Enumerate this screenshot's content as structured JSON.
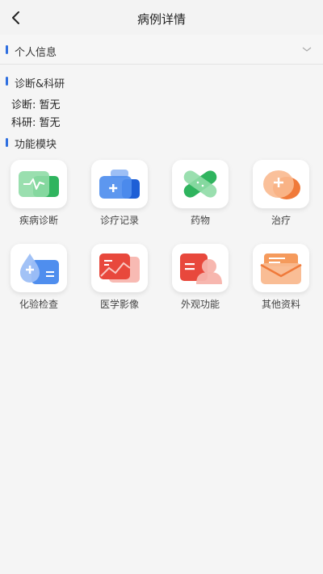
{
  "nav": {
    "title": "病例详情"
  },
  "sections": {
    "personal": "个人信息",
    "diagnosis": "诊断&科研",
    "modules": "功能模块"
  },
  "fields": [
    {
      "label": "诊断:",
      "value": "暂无"
    },
    {
      "label": "科研:",
      "value": "暂无"
    }
  ],
  "modules": [
    {
      "label": "疾病诊断",
      "icon": "disease-diagnosis-icon",
      "color": "#3fbf6a"
    },
    {
      "label": "诊疗记录",
      "icon": "medical-record-icon",
      "color": "#2f73e0"
    },
    {
      "label": "药物",
      "icon": "medicine-icon",
      "color": "#3fbf6a"
    },
    {
      "label": "治疗",
      "icon": "treatment-icon",
      "color": "#f07a3a"
    },
    {
      "label": "化验检查",
      "icon": "lab-test-icon",
      "color": "#2f73e0"
    },
    {
      "label": "医学影像",
      "icon": "medical-imaging-icon",
      "color": "#e8483c"
    },
    {
      "label": "外观功能",
      "icon": "appearance-function-icon",
      "color": "#e8483c"
    },
    {
      "label": "其他资料",
      "icon": "other-info-icon",
      "color": "#f07a3a"
    }
  ],
  "colors": {
    "accent": "#2f6fe0",
    "background": "#f5f5f5"
  }
}
